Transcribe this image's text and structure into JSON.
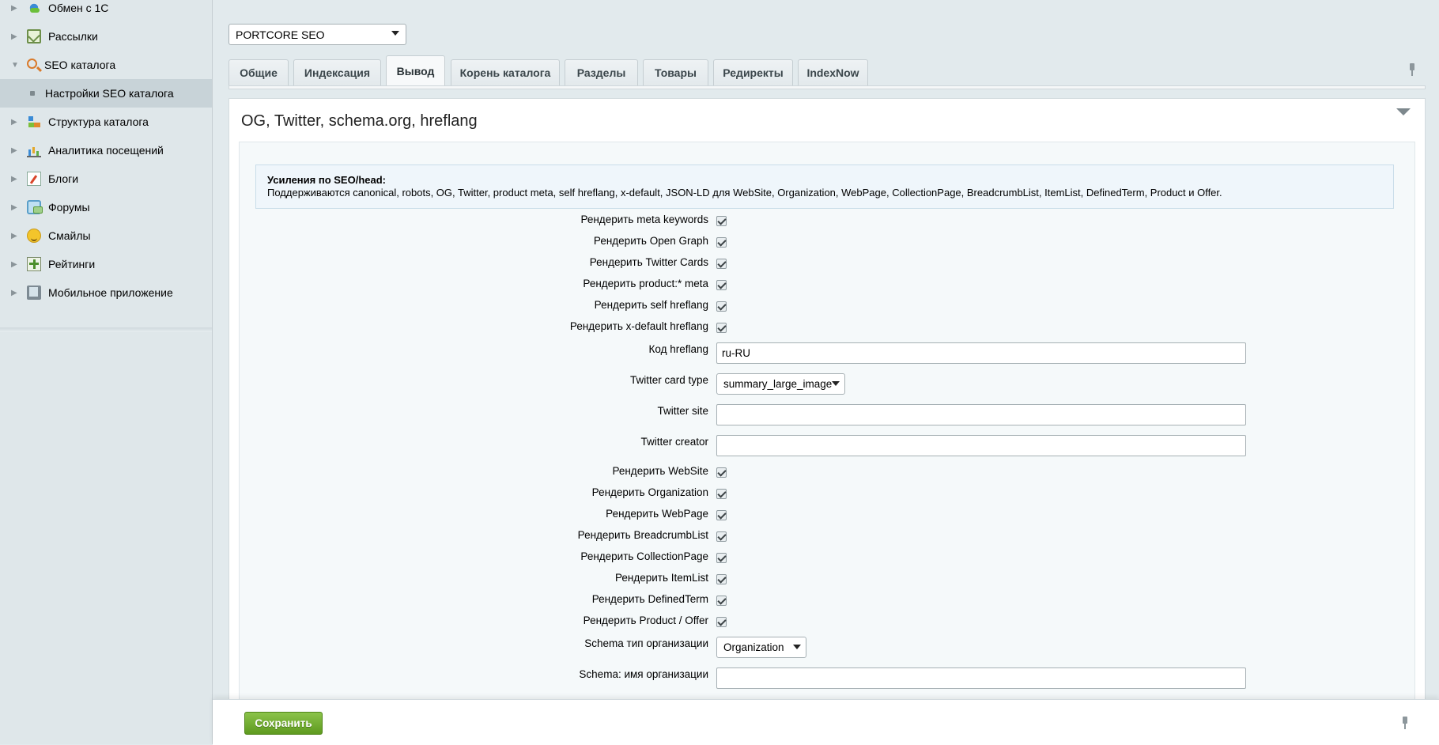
{
  "sidebar": {
    "items": [
      {
        "label": "Обмен с 1С",
        "icon": "exchange-icon"
      },
      {
        "label": "Рассылки",
        "icon": "mail-icon"
      },
      {
        "label": "SEO каталога",
        "icon": "seo-search-icon"
      },
      {
        "label": "Настройки SEO каталога",
        "icon": "bullet"
      },
      {
        "label": "Структура каталога",
        "icon": "structure-icon"
      },
      {
        "label": "Аналитика посещений",
        "icon": "analytics-icon"
      },
      {
        "label": "Блоги",
        "icon": "blog-icon"
      },
      {
        "label": "Форумы",
        "icon": "forum-icon"
      },
      {
        "label": "Смайлы",
        "icon": "smile-icon"
      },
      {
        "label": "Рейтинги",
        "icon": "rating-icon"
      },
      {
        "label": "Мобильное приложение",
        "icon": "mobile-icon"
      }
    ]
  },
  "site_select": {
    "value": "PORTCORE SEO"
  },
  "tabs": [
    {
      "label": "Общие"
    },
    {
      "label": "Индексация"
    },
    {
      "label": "Вывод",
      "active": true
    },
    {
      "label": "Корень каталога"
    },
    {
      "label": "Разделы"
    },
    {
      "label": "Товары"
    },
    {
      "label": "Редиректы"
    },
    {
      "label": "IndexNow"
    }
  ],
  "panel": {
    "title": "OG, Twitter, schema.org, hreflang",
    "notice_title": "Усиления по SEO/head:",
    "notice_text": "Поддерживаются canonical, robots, OG, Twitter, product meta, self hreflang, x-default, JSON-LD для WebSite, Organization, WebPage, CollectionPage, BreadcrumbList, ItemList, DefinedTerm, Product и Offer."
  },
  "fields": {
    "meta_keywords": {
      "label": "Рендерить meta keywords",
      "checked": true
    },
    "open_graph": {
      "label": "Рендерить Open Graph",
      "checked": true
    },
    "twitter_cards": {
      "label": "Рендерить Twitter Cards",
      "checked": true
    },
    "product_meta": {
      "label": "Рендерить product:* meta",
      "checked": true
    },
    "self_hreflang": {
      "label": "Рендерить self hreflang",
      "checked": true
    },
    "x_default": {
      "label": "Рендерить x-default hreflang",
      "checked": true
    },
    "hreflang_code": {
      "label": "Код hreflang",
      "value": "ru-RU"
    },
    "twitter_card_type": {
      "label": "Twitter card type",
      "value": "summary_large_image"
    },
    "twitter_site": {
      "label": "Twitter site",
      "value": ""
    },
    "twitter_creator": {
      "label": "Twitter creator",
      "value": ""
    },
    "website": {
      "label": "Рендерить WebSite",
      "checked": true
    },
    "organization": {
      "label": "Рендерить Organization",
      "checked": true
    },
    "webpage": {
      "label": "Рендерить WebPage",
      "checked": true
    },
    "breadcrumb": {
      "label": "Рендерить BreadcrumbList",
      "checked": true
    },
    "collection": {
      "label": "Рендерить CollectionPage",
      "checked": true
    },
    "itemlist": {
      "label": "Рендерить ItemList",
      "checked": true
    },
    "definedterm": {
      "label": "Рендерить DefinedTerm",
      "checked": true
    },
    "product_offer": {
      "label": "Рендерить Product / Offer",
      "checked": true
    },
    "schema_org_type": {
      "label": "Schema тип организации",
      "value": "Organization"
    },
    "schema_org_name": {
      "label": "Schema: имя организации",
      "value": ""
    }
  },
  "footer": {
    "save_label": "Сохранить"
  }
}
